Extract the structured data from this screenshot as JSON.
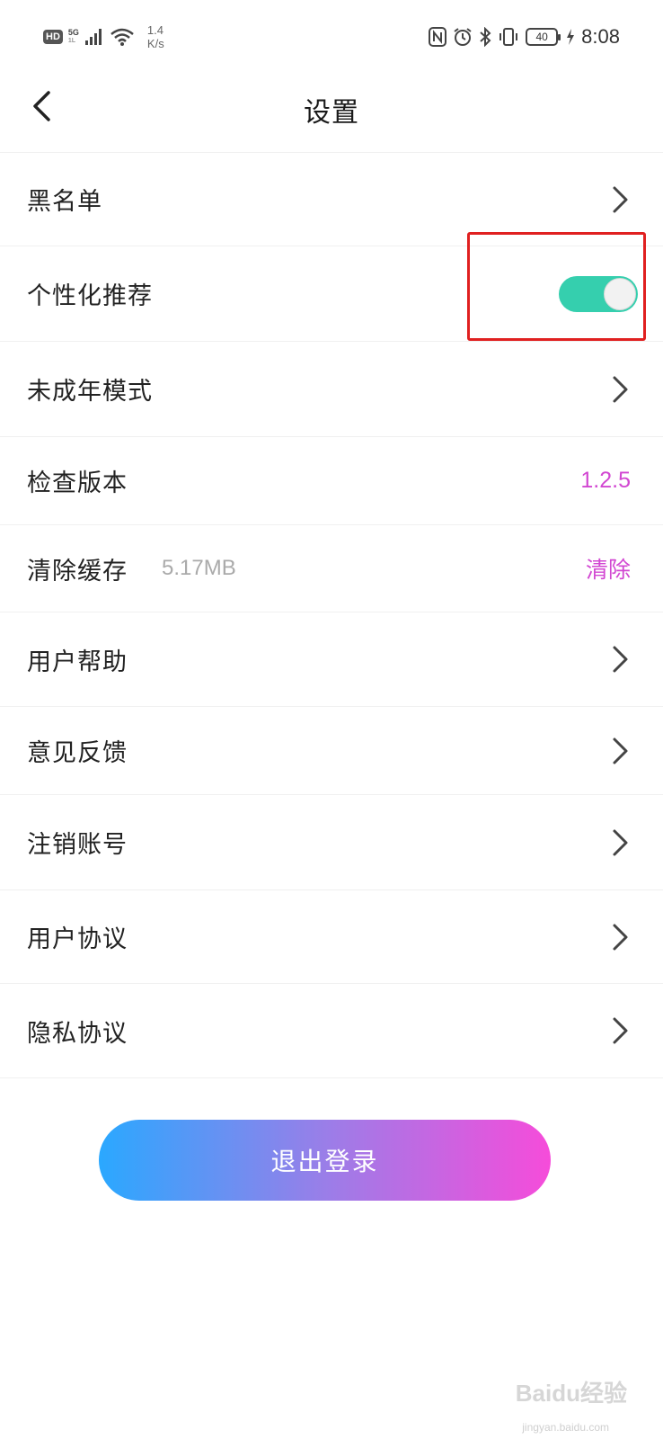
{
  "status_bar": {
    "hd": "HD",
    "net_top": "5G",
    "net_bottom": "1L",
    "speed_value": "1.4",
    "speed_unit": "K/s",
    "battery": "40",
    "time": "8:08",
    "icons": [
      "nfc-icon",
      "alarm-icon",
      "bluetooth-icon",
      "vibrate-icon",
      "battery-icon",
      "charging-icon"
    ]
  },
  "header": {
    "title": "设置"
  },
  "settings": {
    "blacklist": "黑名单",
    "personalized": "个性化推荐",
    "personalized_on": true,
    "minor_mode": "未成年模式",
    "check_version": "检查版本",
    "version": "1.2.5",
    "clear_cache": "清除缓存",
    "cache_size": "5.17MB",
    "clear_action": "清除",
    "help": "用户帮助",
    "feedback": "意见反馈",
    "delete_account": "注销账号",
    "user_agreement": "用户协议",
    "privacy_agreement": "隐私协议"
  },
  "logout": {
    "label": "退出登录"
  },
  "watermark": {
    "main": "Baidu经验",
    "sub": "jingyan.baidu.com"
  },
  "colors": {
    "accent": "#d247d2",
    "toggle_on": "#35cfae",
    "gradient_start": "#2aa8ff",
    "gradient_end": "#f64cda",
    "highlight": "#e02020"
  }
}
